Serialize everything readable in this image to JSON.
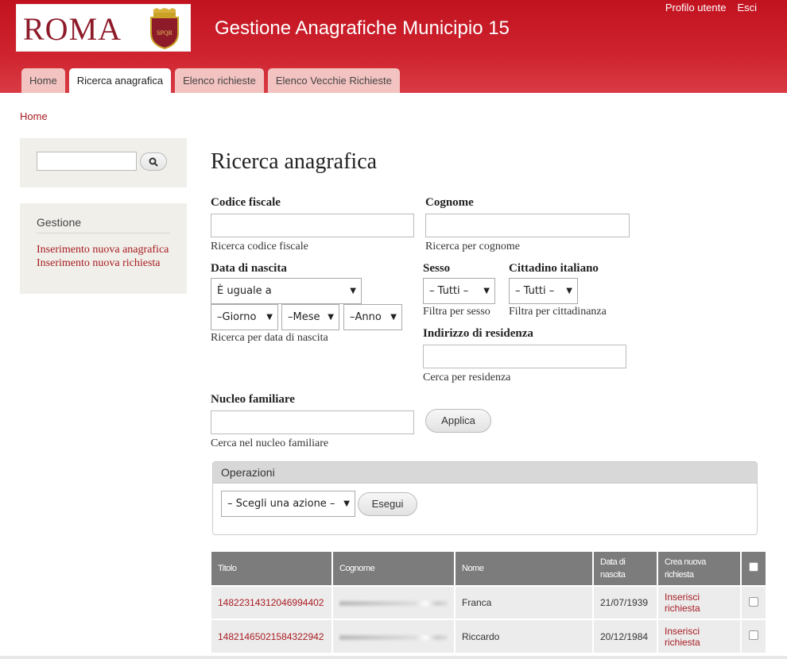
{
  "header": {
    "logo_text": "ROMA",
    "emblem_text": "SPQR",
    "site_title": "Gestione Anagrafiche Municipio 15",
    "links": [
      "Profilo utente",
      "Esci"
    ],
    "tabs": [
      "Home",
      "Ricerca anagrafica",
      "Elenco richieste",
      "Elenco Vecchie Richieste"
    ],
    "active_tab": "Ricerca anagrafica",
    "colors": {
      "primary": "#c1121f",
      "tab_inactive": "#f2c3c0",
      "link": "#a81c22"
    }
  },
  "breadcrumb": "Home",
  "sidebar": {
    "search_placeholder": "",
    "search_icon": "search-icon",
    "menu_title": "Gestione",
    "menu_items": [
      "Inserimento nuova anagrafica",
      "Inserimento nuova richiesta"
    ]
  },
  "main": {
    "title": "Ricerca anagrafica",
    "codice_fiscale": {
      "label": "Codice fiscale",
      "value": "",
      "desc": "Ricerca codice fiscale"
    },
    "cognome": {
      "label": "Cognome",
      "value": "",
      "desc": "Ricerca per cognome"
    },
    "data_nascita": {
      "label": "Data di nascita",
      "operator": "È uguale a",
      "giorno": "–Giorno",
      "mese": "–Mese",
      "anno": "–Anno",
      "desc": "Ricerca per data di nascita"
    },
    "sesso": {
      "label": "Sesso",
      "value": "– Tutti –",
      "desc": "Filtra per sesso"
    },
    "cittadino": {
      "label": "Cittadino italiano",
      "value": "– Tutti –",
      "desc": "Filtra per cittadinanza"
    },
    "indirizzo": {
      "label": "Indirizzo di residenza",
      "value": "",
      "desc": "Cerca per residenza"
    },
    "nucleo": {
      "label": "Nucleo familiare",
      "value": "",
      "desc": "Cerca nel nucleo familiare"
    },
    "apply_button": "Applica"
  },
  "operations": {
    "legend": "Operazioni",
    "action_select": "– Scegli una azione –",
    "execute_button": "Esegui"
  },
  "table": {
    "headers": [
      "Titolo",
      "Cognome",
      "Nome",
      "Data di nascita",
      "Crea nuova richiesta"
    ],
    "rows": [
      {
        "titolo": "14822314312046994402",
        "nome": "Franca",
        "data": "21/07/1939",
        "azione": "Inserisci richiesta"
      },
      {
        "titolo": "14821465021584322942",
        "nome": "Riccardo",
        "data": "20/12/1984",
        "azione": "Inserisci richiesta"
      }
    ]
  }
}
